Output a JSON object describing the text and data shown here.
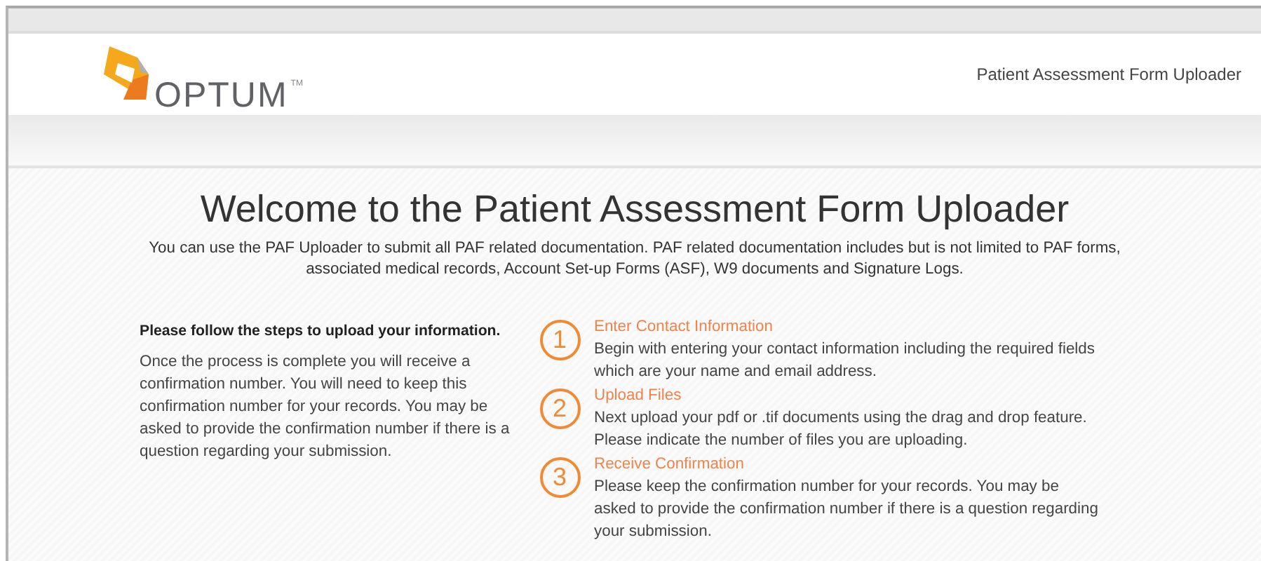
{
  "header": {
    "logo_text": "OPTUM",
    "logo_mark": "TM",
    "title": "Patient Assessment Form Uploader"
  },
  "main": {
    "heading": "Welcome to the Patient Assessment Form Uploader",
    "intro": "You can use the PAF Uploader to submit all PAF related documentation. PAF related documentation includes but is not limited to PAF forms, associated medical records, Account Set-up Forms (ASF), W9 documents and Signature Logs.",
    "instructions_title": "Please follow the steps to upload your information.",
    "instructions": "Once the process is complete you will receive a confirmation number. You will need to keep this confirmation number for your records. You may be asked to provide the confirmation number if there is a question regarding your submission.",
    "steps": [
      {
        "number": "1",
        "title": "Enter Contact Information",
        "text": "Begin with entering your contact information including the required fields which are your name and email address."
      },
      {
        "number": "2",
        "title": "Upload Files",
        "text": "Next upload your pdf or .tif documents using the drag and drop feature. Please indicate the number of files you are uploading."
      },
      {
        "number": "3",
        "title": "Receive Confirmation",
        "text": "Please keep the confirmation number for your records. You may be asked to provide the confirmation number if there is a question regarding your submission."
      }
    ]
  }
}
